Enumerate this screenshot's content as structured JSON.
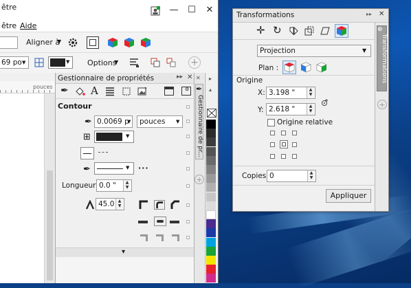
{
  "main_window": {
    "title_fragment": "être",
    "menu_help": "Aide",
    "minimize_glyph": "—",
    "maximize_glyph": "☐",
    "close_glyph": "✕"
  },
  "toolbar1": {
    "align_label": "Aligner à",
    "align_arrow": "▼"
  },
  "toolbar2": {
    "width_value": "69 po",
    "options_label": "Options",
    "options_arrow": "▼"
  },
  "ruler": {
    "unit": "pouces"
  },
  "properties_panel": {
    "title": "Gestionnaire de propriétés",
    "section_title": "Contour",
    "outline_width": "0.0069 p",
    "units": "pouces",
    "length_label": "Longueur :",
    "length_value": "0.0 \"",
    "miter_value": "45.0",
    "vertical_tab": "Gestionnaire de pr...",
    "expand_arrow": "▾"
  },
  "palette": {
    "colors": [
      "#000000",
      "#2b2b2b",
      "#3d3d3d",
      "#545454",
      "#6b6b6b",
      "#838383",
      "#9a9a9a",
      "#b0b0b0",
      "#c6c6c6",
      "#dcdcdc",
      "#ffffff",
      "#4b2b8f",
      "#1b3aa6",
      "#00a3e0",
      "#1aa336",
      "#f3e500",
      "#e8222d",
      "#d12b8e"
    ]
  },
  "transform_dialog": {
    "title": "Transformations",
    "mode_value": "Projection",
    "plane_label": "Plan :",
    "origin_section": "Origine",
    "x_label": "X:",
    "x_value": "3.198 \"",
    "y_label": "Y:",
    "y_value": "2.618 \"",
    "relative_origin_label": "Origine relative",
    "copies_label": "Copies :",
    "copies_value": "0",
    "apply_label": "Appliquer",
    "side_tab": "Transformations",
    "dropdown_arrow": "▼"
  }
}
